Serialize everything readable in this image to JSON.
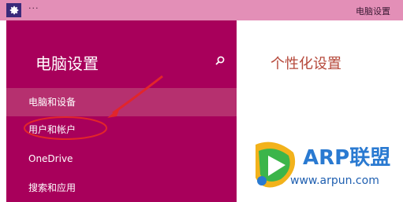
{
  "titlebar": {
    "overflow_label": "···",
    "title": "电脑设置"
  },
  "sidebar": {
    "title": "电脑设置",
    "items": [
      {
        "label": "电脑和设备",
        "selected": true
      },
      {
        "label": "用户和帐户",
        "selected": false,
        "annotated": true
      },
      {
        "label": "OneDrive",
        "selected": false
      },
      {
        "label": "搜索和应用",
        "selected": false
      }
    ]
  },
  "main": {
    "title": "个性化设置"
  },
  "watermark": {
    "brand": "ARP联盟",
    "url": "www.arpun.com"
  },
  "colors": {
    "titlebar": "#e38fb7",
    "sidebar": "#a8005b",
    "selected_item": "#b6306f",
    "main_title": "#b5483a",
    "annotation": "#e2252b"
  },
  "icons": [
    "gear-icon",
    "search-icon"
  ]
}
